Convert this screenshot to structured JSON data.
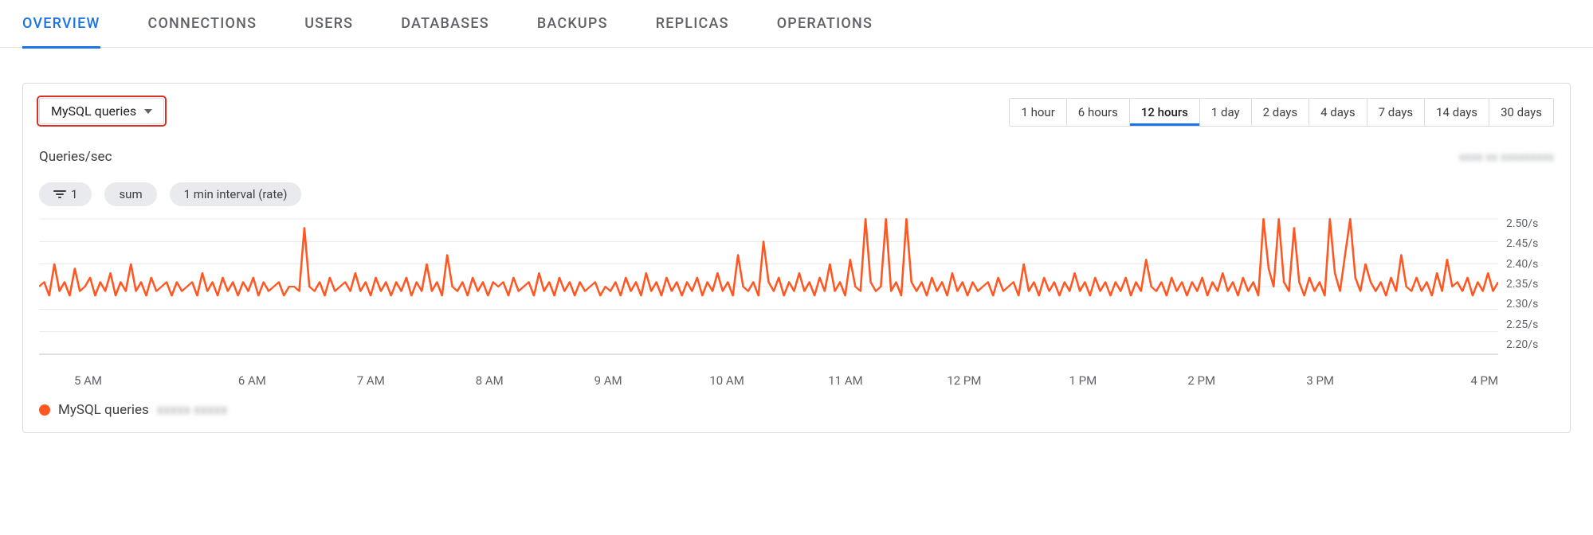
{
  "tabs": [
    "OVERVIEW",
    "CONNECTIONS",
    "USERS",
    "DATABASES",
    "BACKUPS",
    "REPLICAS",
    "OPERATIONS"
  ],
  "active_tab": 0,
  "metric_selector": {
    "label": "MySQL queries"
  },
  "time_ranges": [
    "1 hour",
    "6 hours",
    "12 hours",
    "1 day",
    "2 days",
    "4 days",
    "7 days",
    "14 days",
    "30 days"
  ],
  "active_range": 2,
  "chart_subtitle": "Queries/sec",
  "top_right_blur": "xxxx xx xxxxxxxxx",
  "chips": {
    "filter_count": "1",
    "aggregation": "sum",
    "interval": "1 min interval (rate)"
  },
  "legend": {
    "series_name": "MySQL queries",
    "blur": "xxxxx xxxxx"
  },
  "chart_data": {
    "type": "line",
    "ylabel": "Queries/sec",
    "ylim": [
      2.2,
      2.5
    ],
    "yticks": [
      "2.50/s",
      "2.45/s",
      "2.40/s",
      "2.35/s",
      "2.30/s",
      "2.25/s",
      "2.20/s"
    ],
    "xticks": [
      "5 AM",
      "6 AM",
      "7 AM",
      "8 AM",
      "9 AM",
      "10 AM",
      "11 AM",
      "12 PM",
      "1 PM",
      "2 PM",
      "3 PM",
      "4 PM"
    ],
    "series": [
      {
        "name": "MySQL queries",
        "color": "#ff5722",
        "values": [
          2.35,
          2.36,
          2.33,
          2.4,
          2.34,
          2.36,
          2.33,
          2.39,
          2.34,
          2.35,
          2.37,
          2.33,
          2.36,
          2.34,
          2.38,
          2.33,
          2.36,
          2.34,
          2.4,
          2.34,
          2.36,
          2.33,
          2.37,
          2.34,
          2.35,
          2.36,
          2.33,
          2.36,
          2.34,
          2.35,
          2.36,
          2.33,
          2.38,
          2.34,
          2.36,
          2.33,
          2.37,
          2.34,
          2.36,
          2.33,
          2.36,
          2.34,
          2.37,
          2.33,
          2.36,
          2.34,
          2.35,
          2.36,
          2.33,
          2.35,
          2.35,
          2.34,
          2.48,
          2.35,
          2.34,
          2.36,
          2.33,
          2.37,
          2.34,
          2.35,
          2.36,
          2.34,
          2.38,
          2.34,
          2.36,
          2.33,
          2.37,
          2.34,
          2.36,
          2.33,
          2.36,
          2.34,
          2.37,
          2.33,
          2.36,
          2.34,
          2.4,
          2.34,
          2.36,
          2.33,
          2.42,
          2.35,
          2.34,
          2.36,
          2.33,
          2.37,
          2.34,
          2.36,
          2.33,
          2.36,
          2.35,
          2.36,
          2.33,
          2.37,
          2.34,
          2.35,
          2.36,
          2.33,
          2.38,
          2.34,
          2.36,
          2.33,
          2.37,
          2.34,
          2.36,
          2.33,
          2.36,
          2.34,
          2.35,
          2.36,
          2.33,
          2.35,
          2.34,
          2.36,
          2.33,
          2.37,
          2.34,
          2.36,
          2.33,
          2.38,
          2.34,
          2.36,
          2.33,
          2.37,
          2.34,
          2.36,
          2.33,
          2.36,
          2.34,
          2.37,
          2.33,
          2.36,
          2.34,
          2.38,
          2.34,
          2.36,
          2.33,
          2.42,
          2.35,
          2.34,
          2.36,
          2.33,
          2.45,
          2.36,
          2.34,
          2.37,
          2.33,
          2.36,
          2.34,
          2.38,
          2.34,
          2.36,
          2.33,
          2.37,
          2.34,
          2.4,
          2.34,
          2.36,
          2.33,
          2.41,
          2.35,
          2.34,
          2.5,
          2.36,
          2.34,
          2.35,
          2.5,
          2.34,
          2.36,
          2.33,
          2.5,
          2.36,
          2.34,
          2.36,
          2.33,
          2.37,
          2.34,
          2.36,
          2.33,
          2.38,
          2.34,
          2.36,
          2.33,
          2.36,
          2.34,
          2.35,
          2.36,
          2.33,
          2.37,
          2.34,
          2.35,
          2.36,
          2.33,
          2.4,
          2.34,
          2.36,
          2.33,
          2.37,
          2.34,
          2.36,
          2.33,
          2.36,
          2.34,
          2.38,
          2.34,
          2.36,
          2.33,
          2.37,
          2.34,
          2.36,
          2.33,
          2.36,
          2.34,
          2.37,
          2.33,
          2.36,
          2.34,
          2.41,
          2.35,
          2.34,
          2.36,
          2.33,
          2.37,
          2.34,
          2.36,
          2.33,
          2.36,
          2.34,
          2.37,
          2.33,
          2.36,
          2.34,
          2.38,
          2.34,
          2.36,
          2.33,
          2.37,
          2.34,
          2.36,
          2.33,
          2.5,
          2.39,
          2.35,
          2.5,
          2.36,
          2.34,
          2.48,
          2.36,
          2.33,
          2.37,
          2.34,
          2.36,
          2.33,
          2.5,
          2.38,
          2.34,
          2.42,
          2.5,
          2.37,
          2.34,
          2.4,
          2.36,
          2.34,
          2.36,
          2.33,
          2.37,
          2.34,
          2.42,
          2.35,
          2.34,
          2.37,
          2.34,
          2.36,
          2.33,
          2.38,
          2.34,
          2.41,
          2.35,
          2.36,
          2.34,
          2.37,
          2.33,
          2.36,
          2.34,
          2.38,
          2.34,
          2.36
        ]
      }
    ]
  }
}
